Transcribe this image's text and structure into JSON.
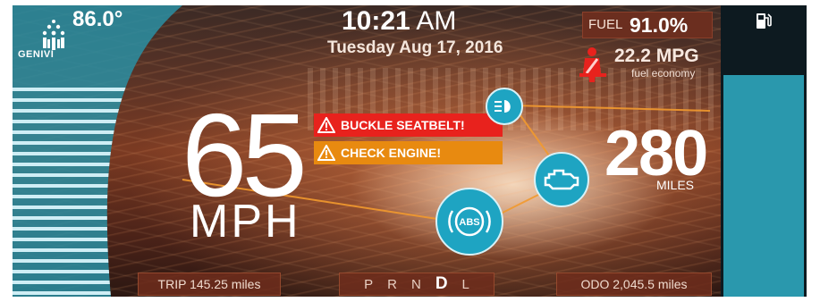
{
  "header": {
    "temperature": "86.0°",
    "logo_text": "GENIVI",
    "time_value": "10:21",
    "time_ampm": "AM",
    "date": "Tuesday Aug 17, 2016"
  },
  "fuel": {
    "label": "FUEL",
    "value": "91.0%",
    "level_fraction": 0.91,
    "economy_value": "22.2 MPG",
    "economy_label": "fuel economy"
  },
  "speed": {
    "value": "65",
    "unit": "MPH"
  },
  "range": {
    "value": "280",
    "unit": "MILES"
  },
  "warnings": [
    {
      "text": "BUCKLE SEATBELT!",
      "color": "#e8221d"
    },
    {
      "text": "CHECK  ENGINE!",
      "color": "#e88a10"
    }
  ],
  "indicators": {
    "abs_text": "ABS",
    "icons": [
      "headlight-icon",
      "engine-icon",
      "abs-icon",
      "seatbelt-icon",
      "fuel-pump-icon"
    ]
  },
  "footer": {
    "trip": "TRIP 145.25 miles",
    "gears": [
      "P",
      "R",
      "N",
      "D",
      "L"
    ],
    "active_gear": "D",
    "odo": "ODO 2,045.5 miles"
  },
  "colors": {
    "accent_teal": "#2a98ad",
    "warning_red": "#e8221d",
    "warning_orange": "#e88a10"
  }
}
